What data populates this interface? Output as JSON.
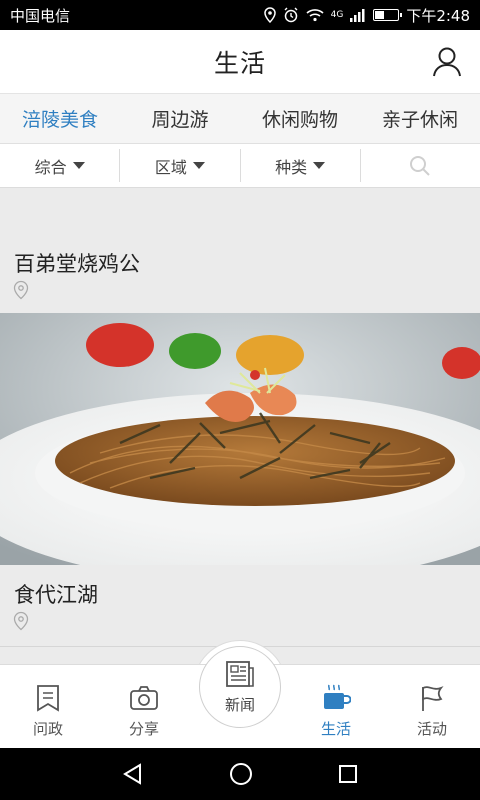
{
  "status_bar": {
    "carrier": "中国电信",
    "network": "4G",
    "time": "下午2:48"
  },
  "header": {
    "title": "生活"
  },
  "category_tabs": [
    {
      "label": "涪陵美食",
      "active": true
    },
    {
      "label": "周边游",
      "active": false
    },
    {
      "label": "休闲购物",
      "active": false
    },
    {
      "label": "亲子休闲",
      "active": false
    }
  ],
  "filters": [
    {
      "label": "综合"
    },
    {
      "label": "区域"
    },
    {
      "label": "种类"
    }
  ],
  "listings": [
    {
      "name": "百弟堂烧鸡公"
    },
    {
      "name": "食代江湖"
    }
  ],
  "bottom_nav": {
    "items": [
      {
        "label": "问政",
        "icon": "bookmark-icon"
      },
      {
        "label": "分享",
        "icon": "camera-icon"
      },
      {
        "label": "新闻",
        "icon": "newspaper-icon"
      },
      {
        "label": "生活",
        "icon": "coffee-cup-icon",
        "active": true
      },
      {
        "label": "活动",
        "icon": "flag-icon"
      }
    ]
  },
  "colors": {
    "accent": "#2f7fc1",
    "background": "#ebebeb"
  }
}
